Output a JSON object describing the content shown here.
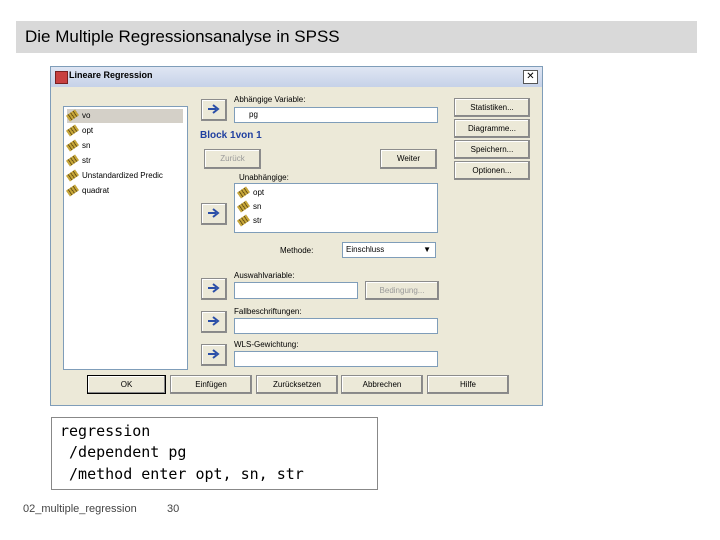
{
  "slide": {
    "title": "Die Multiple Regressionsanalyse in SPSS",
    "footer_name": "02_multiple_regression",
    "page_number": "30"
  },
  "dialog": {
    "title": "Lineare Regression",
    "close_label": "✕",
    "variables": [
      {
        "label": "vo"
      },
      {
        "label": "opt"
      },
      {
        "label": "sn"
      },
      {
        "label": "str"
      },
      {
        "label": "Unstandardized Predic"
      },
      {
        "label": "quadrat"
      }
    ],
    "dependent_label": "Abhängige Variable:",
    "dependent_value": "pg",
    "block_label": "Block 1von 1",
    "back_label": "Zurück",
    "next_label": "Weiter",
    "independent_label": "Unabhängige:",
    "independents": [
      "opt",
      "sn",
      "str"
    ],
    "method_label": "Methode:",
    "method_value": "Einschluss",
    "selection_label": "Auswahlvariable:",
    "condition_label": "Bedingung...",
    "case_label": "Fallbeschriftungen:",
    "wls_label": "WLS-Gewichtung:",
    "side_buttons": [
      "Statistiken...",
      "Diagramme...",
      "Speichern...",
      "Optionen..."
    ],
    "bottom_buttons": [
      "OK",
      "Einfügen",
      "Zurücksetzen",
      "Abbrechen",
      "Hilfe"
    ]
  },
  "syntax": {
    "line1": "regression",
    "line2": " /dependent pg",
    "line3": " /method enter opt, sn, str"
  },
  "colors": {
    "accent": "#2040a0",
    "header_bg": "#d9d9d9",
    "dialog_bg": "#ece9d8"
  }
}
